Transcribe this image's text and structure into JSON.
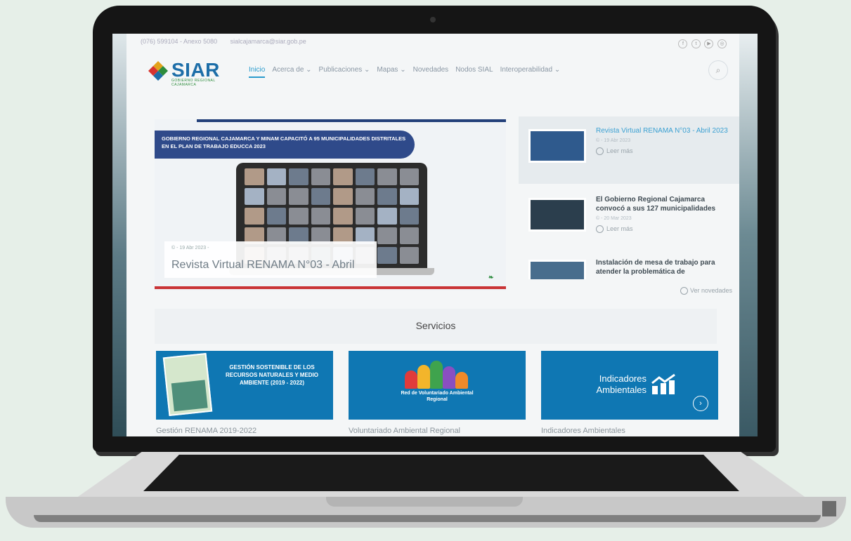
{
  "topbar": {
    "phone": "(076) 599104 - Anexo 5080",
    "email": "sialcajamarca@siar.gob.pe",
    "social_icons": [
      "facebook-icon",
      "twitter-icon",
      "youtube-icon",
      "instagram-icon"
    ]
  },
  "header": {
    "logo_text": "SIAR",
    "logo_subtitle": "GOBIERNO REGIONAL CAJAMARCA",
    "nav": [
      {
        "label": "Inicio",
        "active": true
      },
      {
        "label": "Acerca de ⌄",
        "active": false
      },
      {
        "label": "Publicaciones ⌄",
        "active": false
      },
      {
        "label": "Mapas ⌄",
        "active": false
      },
      {
        "label": "Novedades",
        "active": false
      },
      {
        "label": "Nodos SIAL",
        "active": false
      },
      {
        "label": "Interoperabilidad ⌄",
        "active": false
      }
    ],
    "search_icon": "search-icon"
  },
  "hero": {
    "banner_text": "GOBIERNO REGIONAL CAJAMARCA Y MINAM CAPACITÓ A 95 MUNICIPALIDADES DISTRITALES EN EL PLAN DE TRABAJO EDUCCA 2023",
    "date": "© - 19 Abr 2023 -",
    "title": "Revista Virtual RENAMA N°03 - Abril"
  },
  "news": [
    {
      "title": "Revista Virtual RENAMA N°03 - Abril 2023",
      "date": "© - 19 Abr 2023",
      "more": "Leer más"
    },
    {
      "title": "El Gobierno Regional Cajamarca convocó a sus 127 municipalidades",
      "date": "© - 20 Mar 2023",
      "more": "Leer más"
    },
    {
      "title": "Instalación de mesa de trabajo para atender la problemática de",
      "date": "",
      "more": ""
    }
  ],
  "see_news": "Ver novedades",
  "services": {
    "title": "Servicios",
    "cards": [
      {
        "image_text": "GESTIÓN SOSTENIBLE DE LOS RECURSOS NATURALES Y MEDIO AMBIENTE (2019 - 2022)",
        "label": "Gestión RENAMA 2019-2022"
      },
      {
        "image_text": "Red de Voluntariado Ambiental Regional",
        "label": "Voluntariado Ambiental Regional"
      },
      {
        "image_text": "Indicadores Ambientales",
        "label": "Indicadores Ambientales"
      }
    ]
  },
  "colors": {
    "brand_blue": "#1d6ea8",
    "card_blue": "#0f77b3",
    "link_blue": "#2a9bcd",
    "accent_red": "#c93436"
  }
}
